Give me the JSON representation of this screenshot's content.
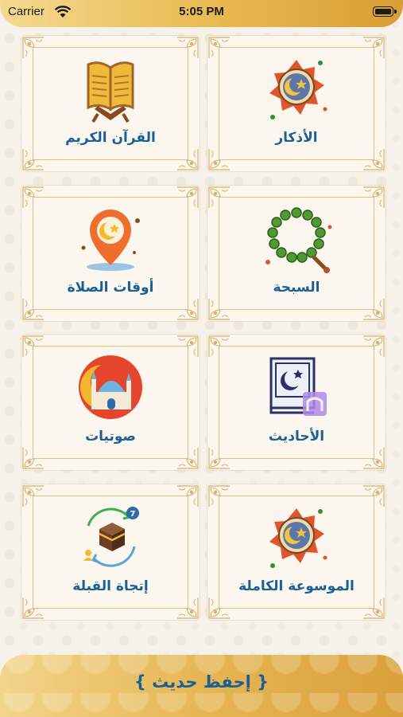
{
  "status_bar": {
    "carrier": "Carrier",
    "time": "5:05 PM"
  },
  "grid": {
    "items": [
      {
        "label": "القرآن الكريم",
        "icon": "quran-book-icon"
      },
      {
        "label": "الأذكار",
        "icon": "crescent-star-emblem-icon"
      },
      {
        "label": "أوقات الصلاة",
        "icon": "prayer-location-pin-icon"
      },
      {
        "label": "السبحة",
        "icon": "prayer-beads-icon"
      },
      {
        "label": "صوتيات",
        "icon": "mosque-audio-icon"
      },
      {
        "label": "الأحاديث",
        "icon": "hadith-book-icon"
      },
      {
        "label": "إتجاة القبلة",
        "icon": "qibla-kaaba-icon"
      },
      {
        "label": "الموسوعة الكاملة",
        "icon": "encyclopedia-emblem-icon"
      }
    ]
  },
  "bottom_banner": {
    "label": "{ إحفظ حديث }"
  },
  "colors": {
    "accent_gold": "#e6b653",
    "label_blue": "#1a5f96",
    "card_bg": "#fbf6ee"
  }
}
